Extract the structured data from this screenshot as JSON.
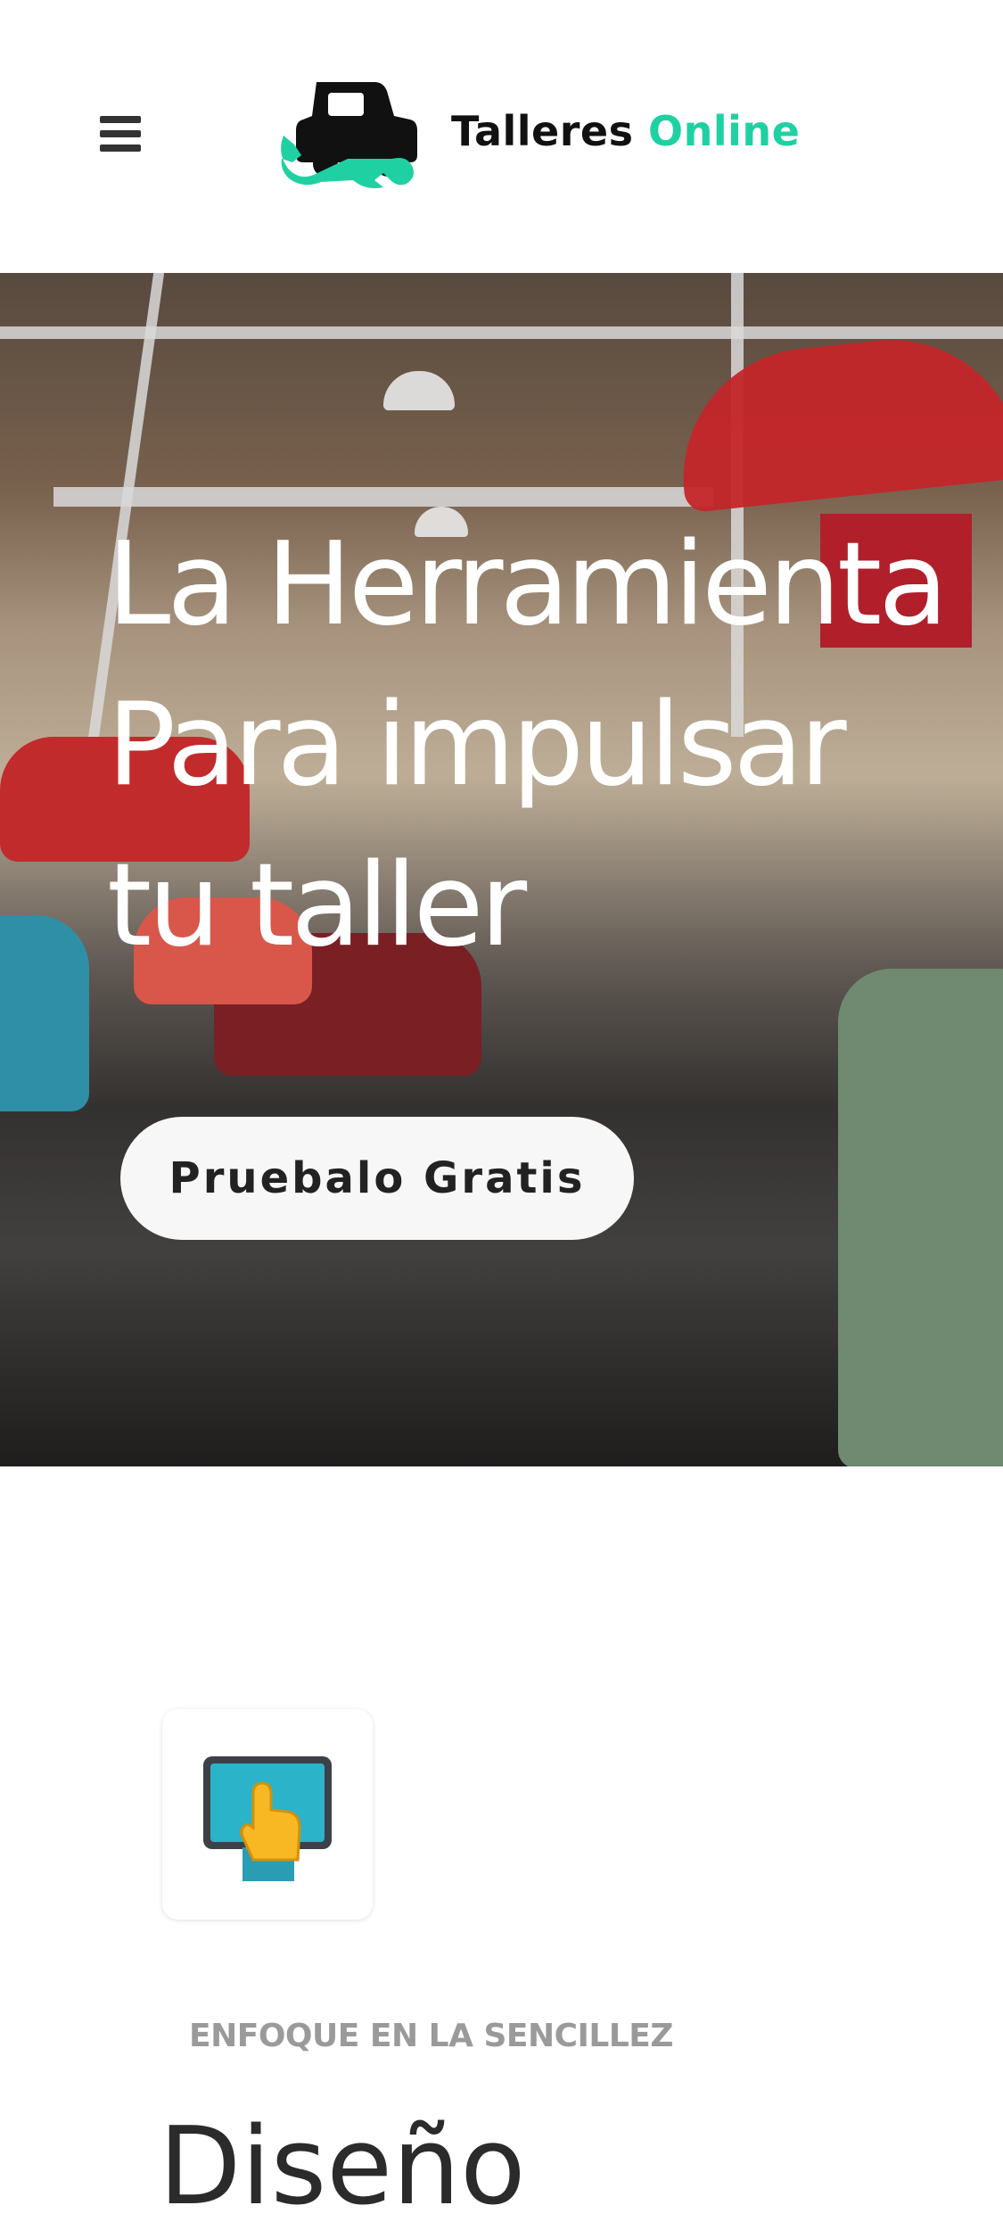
{
  "header": {
    "brand_word1": "Talleres",
    "brand_word2": "Online",
    "brand_accent_color": "#1fd1a2",
    "menu_icon": "hamburger-menu-icon",
    "logo_icon": "car-wrench-icon"
  },
  "hero": {
    "title_line1": "La Herramienta",
    "title_line2": "Para impulsar",
    "title_line3": "tu taller",
    "cta_label": "Pruebalo Gratis"
  },
  "feature": {
    "icon": "tablet-touch-icon",
    "kicker": "ENFOQUE EN LA SENCILLEZ",
    "title": "Diseño"
  }
}
